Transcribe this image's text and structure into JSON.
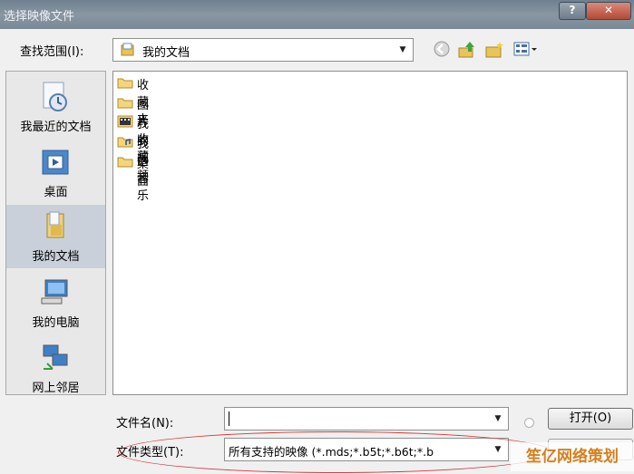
{
  "window": {
    "title": "选择映像文件",
    "help_glyph": "?",
    "close_glyph": "✕"
  },
  "lookin": {
    "label": "查找范围(I):",
    "value": "我的文档"
  },
  "toolbar_icons": [
    "back-icon",
    "up-folder-icon",
    "new-folder-icon",
    "views-menu-icon"
  ],
  "places": [
    {
      "label": "我最近的文档",
      "icon": "recent-documents-icon",
      "selected": false
    },
    {
      "label": "桌面",
      "icon": "desktop-icon",
      "selected": false
    },
    {
      "label": "我的文档",
      "icon": "my-documents-icon",
      "selected": true
    },
    {
      "label": "我的电脑",
      "icon": "my-computer-icon",
      "selected": false
    },
    {
      "label": "网上邻居",
      "icon": "network-places-icon",
      "selected": false
    }
  ],
  "files": [
    {
      "name": "收藏夹",
      "icon": "folder-icon"
    },
    {
      "name": "图片收藏",
      "icon": "folder-icon"
    },
    {
      "name": "我的视频",
      "icon": "video-folder-icon"
    },
    {
      "name": "我的音乐",
      "icon": "music-folder-icon"
    },
    {
      "name": "桌面",
      "icon": "folder-icon"
    }
  ],
  "filename": {
    "label": "文件名(N):",
    "value": ""
  },
  "filetype": {
    "label": "文件类型(T):",
    "value": "所有支持的映像 (*.mds;*.b5t;*.b6t;*.b"
  },
  "buttons": {
    "open": "打开(O)"
  },
  "watermark": "笙亿网络策划",
  "colors": {
    "annotation": "#d23b3b",
    "watermark": "#d6801e",
    "selected_place": "#c9d0d9"
  }
}
